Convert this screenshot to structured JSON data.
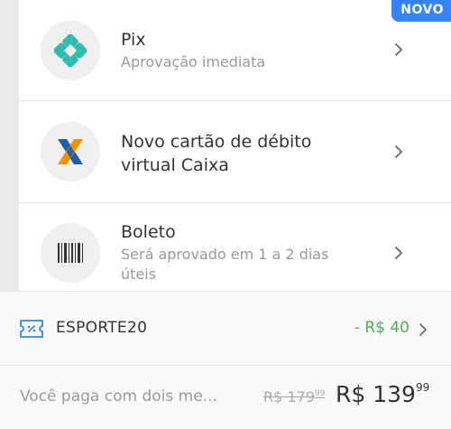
{
  "badge": {
    "label": "NOVO"
  },
  "payment_methods": [
    {
      "title": "Pix",
      "subtitle": "Aprovação imediata",
      "icon": "pix-icon"
    },
    {
      "title": "Novo cartão de débito virtual Caixa",
      "subtitle": "",
      "icon": "caixa-icon"
    },
    {
      "title": "Boleto",
      "subtitle": "Será aprovado em 1 a 2 dias úteis",
      "icon": "barcode-icon"
    }
  ],
  "coupon": {
    "code": "ESPORTE20",
    "discount": "- R$ 40",
    "icon": "coupon-ticket-icon"
  },
  "summary": {
    "label": "Você paga com dois me...",
    "old_price": "R$ 179",
    "old_price_cents": "99",
    "new_price": "R$ 139",
    "new_price_cents": "99"
  },
  "colors": {
    "accent": "#3483fa",
    "pix": "#32bcad",
    "caixa_blue": "#1c60ab",
    "caixa_orange": "#f39200",
    "discount": "#4caf50"
  }
}
